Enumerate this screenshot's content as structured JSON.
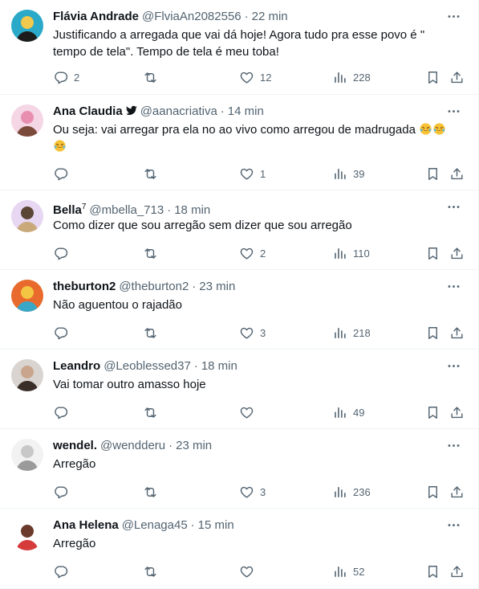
{
  "tweets": [
    {
      "name": "Flávia Andrade",
      "handle": "@FlviaAn2082556",
      "time": "22 min",
      "verified": false,
      "text": "Justificando a arregada que vai dá hoje! Agora tudo pra esse povo é \" tempo de tela\". Tempo de tela é meu toba!",
      "replies": "2",
      "retweets": "",
      "likes": "12",
      "views": "228",
      "avatar_icon": "cartoon-avatar",
      "avatar_colors": [
        "#2aa9c9",
        "#1c1c1c",
        "#f2c94c"
      ]
    },
    {
      "name": "Ana Claudia",
      "handle": "@aanacriativa",
      "time": "14 min",
      "verified": true,
      "text": "Ou seja: vai arregar pra ela no ao vivo como arregou de madrugada",
      "emoji_count": 3,
      "emoji_icon": "rolling-on-floor-laughing-emoji",
      "replies": "",
      "retweets": "",
      "likes": "1",
      "views": "39",
      "avatar_icon": "doll-avatar",
      "avatar_colors": [
        "#f5d6e4",
        "#7a4a3a",
        "#e88fb0"
      ]
    },
    {
      "name": "Bella",
      "name_sup": "7",
      "handle": "@mbella_713",
      "time": "18 min",
      "verified": false,
      "text": "Como dizer que sou arregão sem dizer que sou arregão",
      "replies": "",
      "retweets": "",
      "likes": "2",
      "views": "110",
      "avatar_icon": "character-avatar",
      "avatar_colors": [
        "#e7d7f2",
        "#c9a97a",
        "#5b4636"
      ]
    },
    {
      "name": "theburton2",
      "handle": "@theburton2",
      "time": "23 min",
      "verified": false,
      "text": "Não aguentou o rajadão",
      "replies": "",
      "retweets": "",
      "likes": "3",
      "views": "218",
      "avatar_icon": "colorful-avatar",
      "avatar_colors": [
        "#e86a2c",
        "#3aa7c8",
        "#f4c542"
      ]
    },
    {
      "name": "Leandro",
      "handle": "@Leoblessed37",
      "time": "18 min",
      "verified": false,
      "text": "Vai tomar outro amasso hoje",
      "replies": "",
      "retweets": "",
      "likes": "",
      "views": "49",
      "avatar_icon": "photo-avatar",
      "avatar_colors": [
        "#d9d4cf",
        "#3a2e28",
        "#c9a58d"
      ]
    },
    {
      "name": "wendel.",
      "handle": "@wendderu",
      "time": "23 min",
      "verified": false,
      "text": "Arregão",
      "replies": "",
      "retweets": "",
      "likes": "3",
      "views": "236",
      "avatar_icon": "cat-avatar",
      "avatar_colors": [
        "#f2f2f2",
        "#9a9a9a",
        "#c8c8c8"
      ]
    },
    {
      "name": "Ana Helena",
      "handle": "@Lenaga45",
      "time": "15 min",
      "verified": false,
      "text": "Arregão",
      "replies": "",
      "retweets": "",
      "likes": "",
      "views": "52",
      "avatar_icon": "red-character-avatar",
      "avatar_colors": [
        "#ffffff",
        "#d63b3b",
        "#6b3a2a"
      ]
    }
  ],
  "colors": {
    "text": "#0f1419",
    "secondary": "#536471",
    "border": "#eff3f4",
    "verified": "#1d9bf0"
  }
}
